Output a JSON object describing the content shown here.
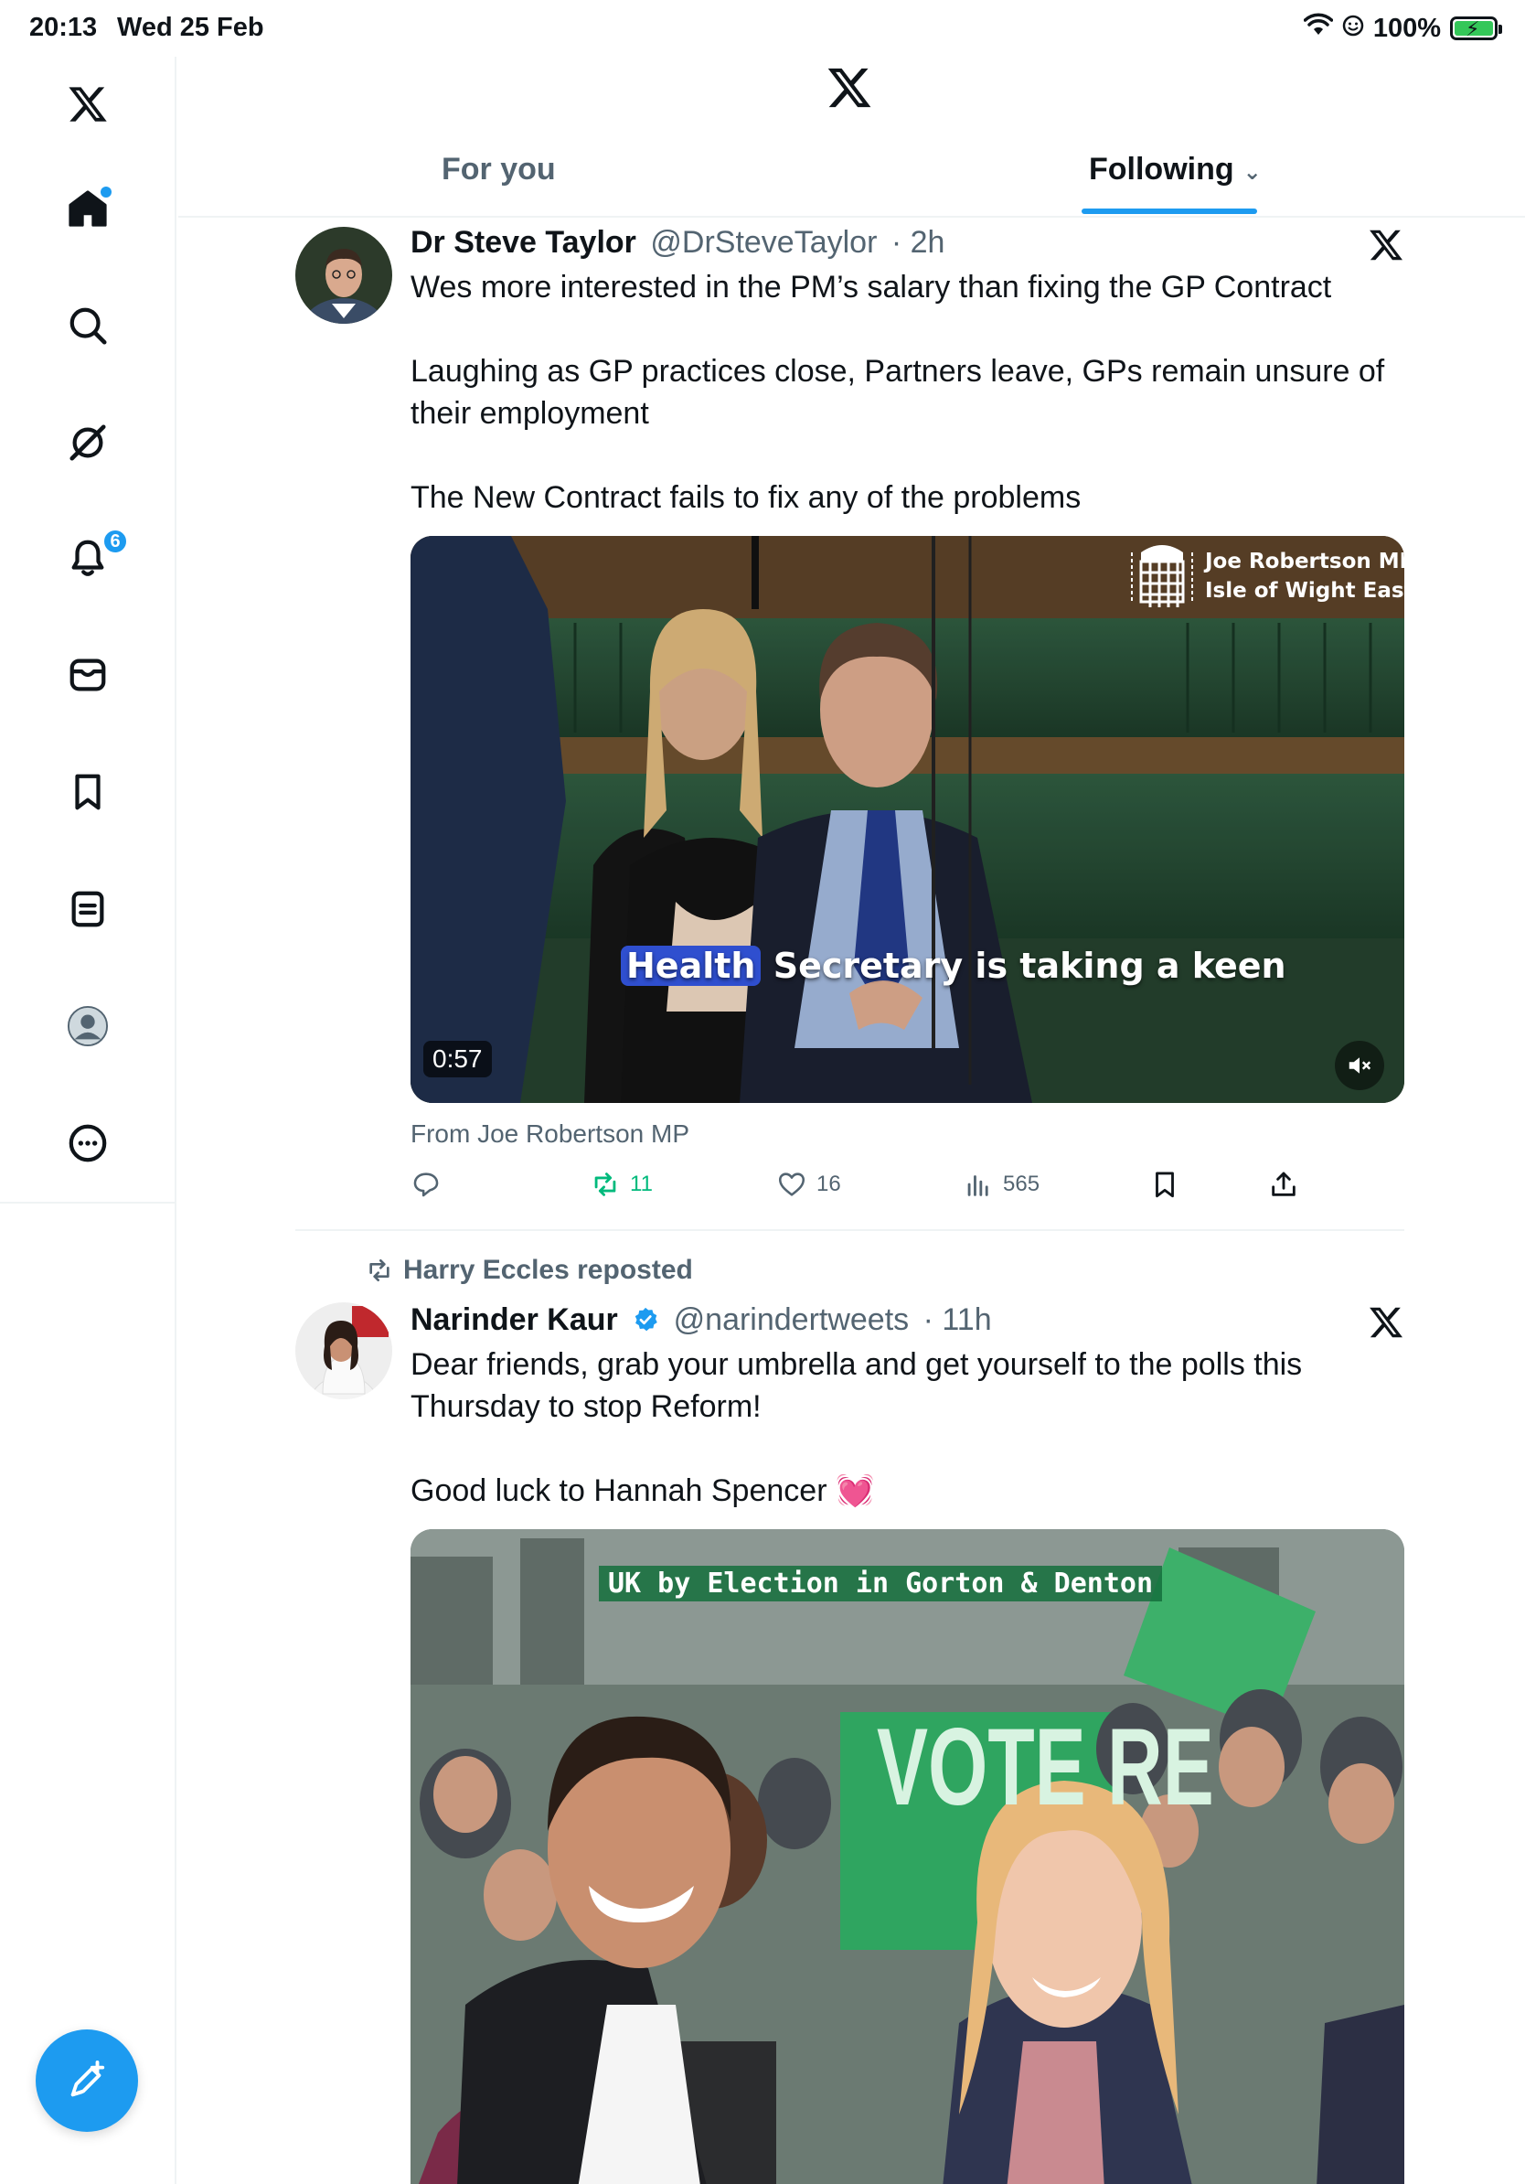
{
  "status_bar": {
    "time": "20:13",
    "date": "Wed 25 Feb",
    "battery": "100%"
  },
  "sidebar": {
    "notifications_badge": "6",
    "items": [
      {
        "name": "home-icon"
      },
      {
        "name": "search-icon"
      },
      {
        "name": "grok-icon"
      },
      {
        "name": "notifications-icon"
      },
      {
        "name": "messages-icon"
      },
      {
        "name": "bookmarks-icon"
      },
      {
        "name": "lists-icon"
      },
      {
        "name": "profile-icon"
      },
      {
        "name": "more-icon"
      }
    ]
  },
  "header": {
    "tabs": [
      {
        "label": "For you"
      },
      {
        "label": "Following"
      }
    ],
    "active_tab": "Following"
  },
  "tweets": [
    {
      "name": "Dr Steve Taylor",
      "handle": "@DrSteveTaylor",
      "time": "· 2h",
      "lines": [
        "Wes more interested in the PM’s salary than fixing the GP Contract",
        "Laughing as GP practices close, Partners leave, GPs remain unsure of their employment",
        "The New Contract fails to fix any of the problems"
      ],
      "media": {
        "overlay_name": "Joe Robertson MP",
        "overlay_place": "Isle of Wight East",
        "caption_highlight": "Health",
        "caption_rest": " Secretary is taking a keen",
        "duration": "0:57"
      },
      "from": "From Joe Robertson MP",
      "reposts": "11",
      "likes": "16",
      "views": "565"
    },
    {
      "repost_by": "Harry Eccles reposted",
      "name": "Narinder Kaur",
      "handle": "@narindertweets",
      "time": "· 11h",
      "lines": [
        "Dear friends, grab your umbrella and get yourself to the polls this Thursday to stop Reform!",
        "Good luck to Hannah Spencer 💓"
      ],
      "media": {
        "banner": "UK by Election in Gorton & Denton",
        "sign_text": "VOTE RE"
      }
    }
  ],
  "colors": {
    "accent": "#1d9bf0",
    "repost_green": "#00ba7c",
    "text_secondary": "#536471"
  }
}
